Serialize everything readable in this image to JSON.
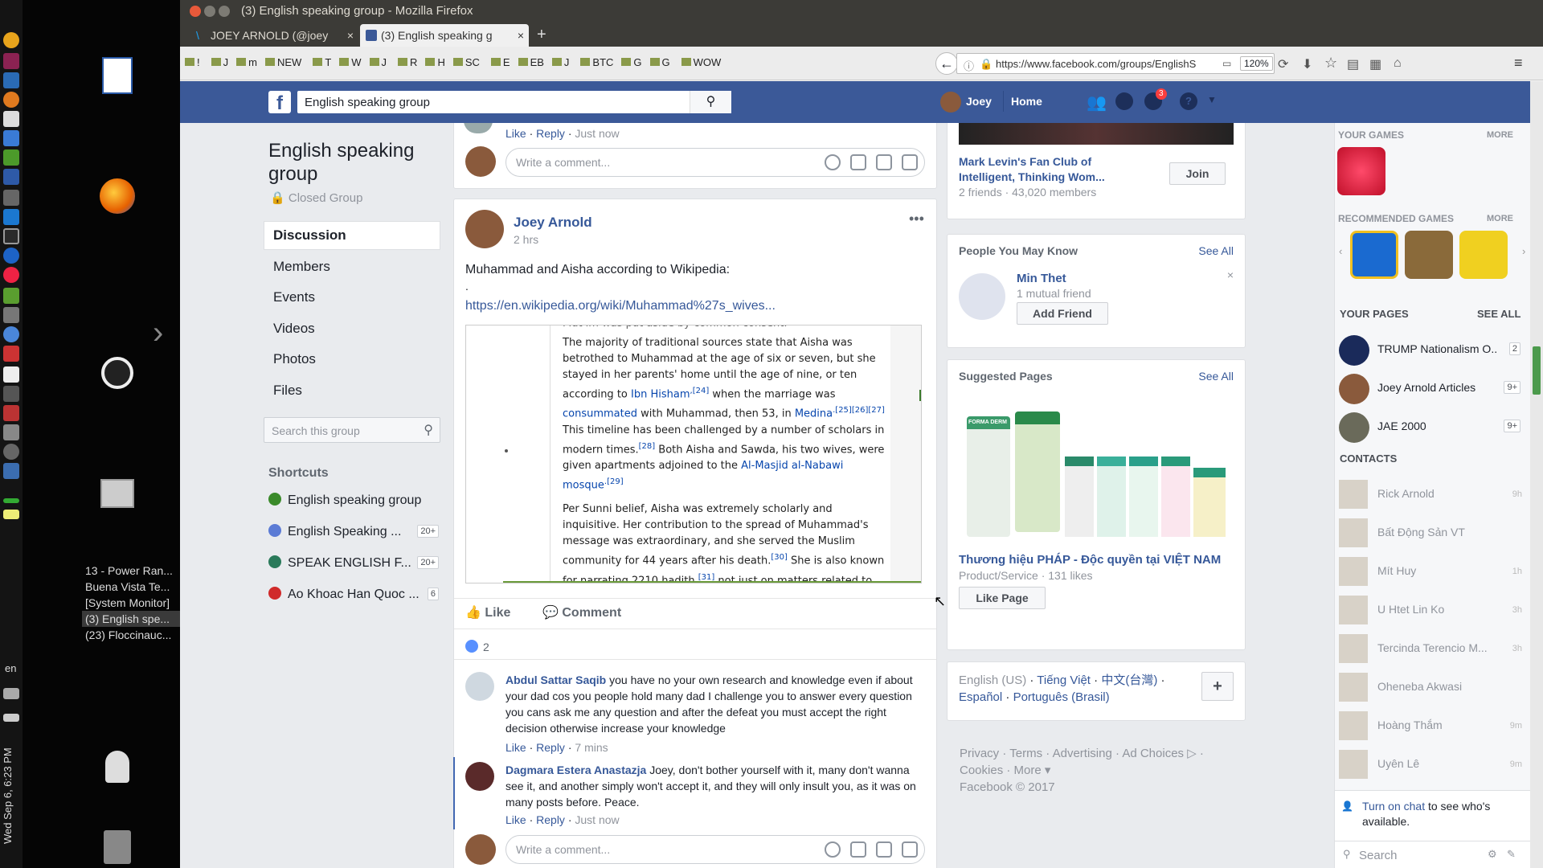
{
  "window": {
    "title": "(3) English speaking group - Mozilla Firefox"
  },
  "tabs": [
    {
      "label": "JOEY ARNOLD (@joey"
    },
    {
      "label": "(3) English speaking g"
    }
  ],
  "bookmarks": [
    "!",
    "J",
    "m",
    "NEW",
    "T",
    "W",
    "J",
    "R",
    "H",
    "SC",
    "E",
    "EB",
    "J",
    "BTC",
    "G",
    "G",
    "WOW"
  ],
  "url": {
    "value": "https://www.facebook.com/groups/EnglishSp",
    "zoom": "120%"
  },
  "header": {
    "search_value": "English speaking group",
    "user": "Joey",
    "home": "Home",
    "notif_count": "3"
  },
  "group": {
    "name": "English speaking group",
    "privacy": "Closed Group",
    "nav": [
      "Discussion",
      "Members",
      "Events",
      "Videos",
      "Photos",
      "Files"
    ],
    "search_placeholder": "Search this group",
    "shortcuts_title": "Shortcuts",
    "shortcuts": [
      {
        "label": "English speaking group",
        "count": ""
      },
      {
        "label": "English Speaking ...",
        "count": "20+"
      },
      {
        "label": "SPEAK ENGLISH F...",
        "count": "20+"
      },
      {
        "label": "Ao Khoac Han Quoc ...",
        "count": "6"
      }
    ]
  },
  "prev_post": {
    "like": "Like",
    "reply": "Reply",
    "time": "Just now",
    "comment_placeholder": "Write a comment..."
  },
  "post": {
    "author": "Joey Arnold",
    "time": "2 hrs",
    "text": "Muhammad and Aisha according to Wikipedia:",
    "dot": ".",
    "link": "https://en.wikipedia.org/wiki/Muhammad%27s_wives...",
    "preview_top": "Mut im was put aside by common consent.",
    "para1": [
      "The majority of traditional sources state that Aisha was betrothed to Muhammad at the age of six or seven, but she stayed in her parents' home until the age of nine, or ten according to ",
      "Ibn Hisham",
      ",[24]",
      " when the marriage was ",
      "consummated",
      " with Muhammad, then 53, in ",
      "Medina",
      ".[25][26][27]",
      " This timeline has been challenged by a number of scholars in modern times.",
      "[28]",
      " Both Aisha and Sawda, his two wives, were given apartments adjoined to the ",
      "Al-Masjid al-Nabawi mosque",
      ".[29]"
    ],
    "para2": [
      "Per Sunni belief, Aisha was extremely scholarly and inquisitive. Her contribution to the spread of Muhammad's message was extraordinary, and she served the Muslim community for 44 years after his death.",
      "[30]",
      " She is also known for narrating 2210 hadith,",
      "[31]",
      " not just on matters related to Muhammad's private life, but also on topics such as"
    ],
    "like_label": "Like",
    "comment_label": "Comment",
    "reactions": "2"
  },
  "comments": [
    {
      "author": "Abdul Sattar Saqib",
      "text": "you have no your own research and knowledge even if about your dad cos you people hold many dad I challenge you to answer every question you cans ask me any question and after the defeat you must accept the right decision otherwise increase your knowledge",
      "like": "Like",
      "reply": "Reply",
      "time": "7 mins"
    },
    {
      "author": "Dagmara Estera Anastazja",
      "text": "Joey, don't bother yourself with it, many don't wanna see it, and another simply won't accept it, and they will only insult you, as it was on many posts before. Peace.",
      "like": "Like",
      "reply": "Reply",
      "time": "Just now"
    }
  ],
  "comment_placeholder": "Write a comment...",
  "group_suggest": {
    "name": "Mark Levin's Fan Club of Intelligent, Thinking Wom...",
    "meta": "2 friends · 43,020 members",
    "join": "Join"
  },
  "pymk": {
    "title": "People You May Know",
    "see_all": "See All",
    "name": "Min Thet",
    "mutual": "1 mutual friend",
    "add": "Add Friend"
  },
  "suggested_pages": {
    "title": "Suggested Pages",
    "see_all": "See All",
    "page_name": "Thương hiệu PHÁP - Độc quyền tại VIỆT NAM",
    "meta": "Product/Service · 131 likes",
    "like": "Like Page",
    "brand": "FORMA DERM"
  },
  "languages": {
    "current": "English (US)",
    "others": [
      "Tiếng Việt",
      "中文(台灣)",
      "Español",
      "Português (Brasil)"
    ]
  },
  "footer": {
    "links": [
      "Privacy",
      "Terms",
      "Advertising",
      "Ad Choices",
      "Cookies",
      "More"
    ],
    "copy": "Facebook © 2017"
  },
  "right": {
    "your_games": "YOUR GAMES",
    "more": "MORE",
    "recommended": "RECOMMENDED GAMES",
    "your_pages": "YOUR PAGES",
    "see_all": "SEE ALL",
    "pages": [
      {
        "name": "TRUMP Nationalism O...",
        "count": "2"
      },
      {
        "name": "Joey Arnold Articles",
        "count": "9+"
      },
      {
        "name": "JAE 2000",
        "count": "9+"
      }
    ],
    "contacts_title": "CONTACTS",
    "contacts": [
      {
        "name": "Rick Arnold",
        "time": "9h"
      },
      {
        "name": "Bất Động Sản VT",
        "time": ""
      },
      {
        "name": "Mít Huy",
        "time": "1h"
      },
      {
        "name": "U Htet Lin Ko",
        "time": "3h"
      },
      {
        "name": "Tercinda Terencio M...",
        "time": "3h"
      },
      {
        "name": "Oheneba Akwasi",
        "time": ""
      },
      {
        "name": "Hoàng Thắm",
        "time": "9m"
      },
      {
        "name": "Uyên Lê",
        "time": "9m"
      }
    ],
    "chat_link": "Turn on chat",
    "chat_rest": " to see who's available.",
    "search_placeholder": "Search"
  },
  "desktop": {
    "windows": [
      "13 - Power Ran...",
      "Buena Vista Te...",
      "[System Monitor]",
      "(3) English spe...",
      "(23) Floccinauc..."
    ],
    "lang": "en",
    "clock": "Wed Sep 6, 6:23 PM"
  }
}
